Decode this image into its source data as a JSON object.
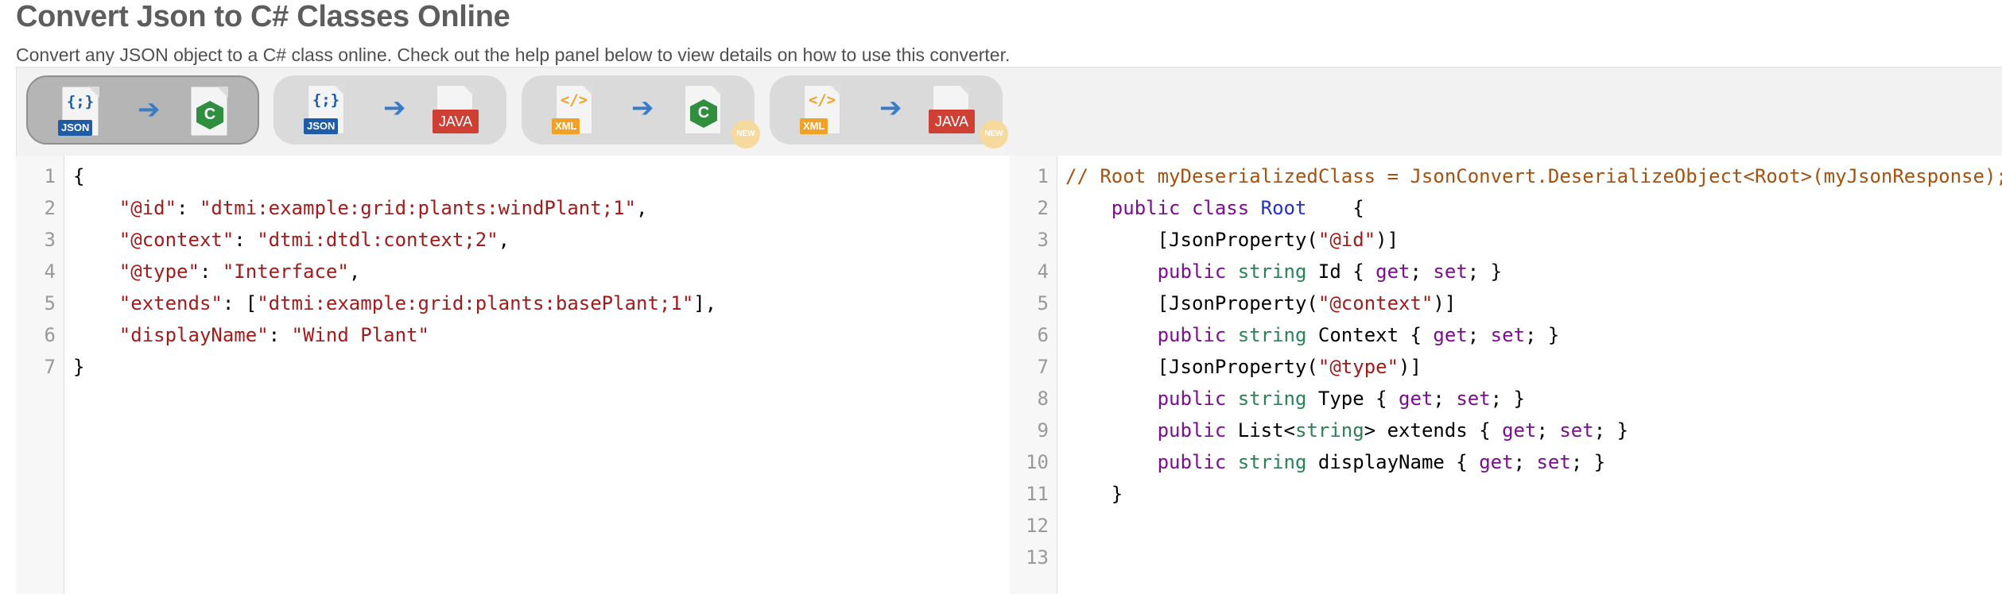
{
  "page": {
    "title": "Convert Json to C# Classes Online",
    "subtitle": "Convert any JSON object to a C# class online. Check out the help panel below to view details on how to use this converter."
  },
  "converters": [
    {
      "from_label": "JSON",
      "from_glyph": "{;}",
      "to_label": "C",
      "active": true,
      "new": false
    },
    {
      "from_label": "JSON",
      "from_glyph": "{;}",
      "to_label": "JAVA",
      "active": false,
      "new": false
    },
    {
      "from_label": "XML",
      "from_glyph": "</>",
      "to_label": "C",
      "active": false,
      "new": true
    },
    {
      "from_label": "XML",
      "from_glyph": "</>",
      "to_label": "JAVA",
      "active": false,
      "new": true
    }
  ],
  "arrow_glyph": "➔",
  "new_badge_text": "NEW",
  "input_editor": {
    "line_numbers": [
      "1",
      "2",
      "3",
      "4",
      "5",
      "6",
      "7"
    ],
    "lines": [
      [
        {
          "cls": "d",
          "text": "{"
        }
      ],
      [
        {
          "cls": "s",
          "text": "    \"@id\""
        },
        {
          "cls": "d",
          "text": ": "
        },
        {
          "cls": "s",
          "text": "\"dtmi:example:grid:plants:windPlant;1\""
        },
        {
          "cls": "d",
          "text": ","
        }
      ],
      [
        {
          "cls": "s",
          "text": "    \"@context\""
        },
        {
          "cls": "d",
          "text": ": "
        },
        {
          "cls": "s",
          "text": "\"dtmi:dtdl:context;2\""
        },
        {
          "cls": "d",
          "text": ","
        }
      ],
      [
        {
          "cls": "s",
          "text": "    \"@type\""
        },
        {
          "cls": "d",
          "text": ": "
        },
        {
          "cls": "s",
          "text": "\"Interface\""
        },
        {
          "cls": "d",
          "text": ","
        }
      ],
      [
        {
          "cls": "s",
          "text": "    \"extends\""
        },
        {
          "cls": "d",
          "text": ": ["
        },
        {
          "cls": "s",
          "text": "\"dtmi:example:grid:plants:basePlant;1\""
        },
        {
          "cls": "d",
          "text": "],"
        }
      ],
      [
        {
          "cls": "s",
          "text": "    \"displayName\""
        },
        {
          "cls": "d",
          "text": ": "
        },
        {
          "cls": "s",
          "text": "\"Wind Plant\""
        }
      ],
      [
        {
          "cls": "d",
          "text": "}"
        }
      ]
    ]
  },
  "output_editor": {
    "line_numbers": [
      "1",
      "2",
      "3",
      "4",
      "5",
      "6",
      "7",
      "8",
      "9",
      "10",
      "11",
      "12",
      "13"
    ],
    "lines": [
      [
        {
          "cls": "c",
          "text": "// Root myDeserializedClass = JsonConvert.DeserializeObject<Root>(myJsonResponse);"
        }
      ],
      [
        {
          "cls": "k",
          "text": "    public class "
        },
        {
          "cls": "p",
          "text": "Root"
        },
        {
          "cls": "d",
          "text": "    {"
        }
      ],
      [
        {
          "cls": "d",
          "text": "        [JsonProperty("
        },
        {
          "cls": "s",
          "text": "\"@id\""
        },
        {
          "cls": "d",
          "text": ")]"
        }
      ],
      [
        {
          "cls": "k",
          "text": "        public "
        },
        {
          "cls": "t",
          "text": "string"
        },
        {
          "cls": "d",
          "text": " Id { "
        },
        {
          "cls": "k",
          "text": "get"
        },
        {
          "cls": "d",
          "text": "; "
        },
        {
          "cls": "k",
          "text": "set"
        },
        {
          "cls": "d",
          "text": "; }"
        }
      ],
      [
        {
          "cls": "d",
          "text": "        [JsonProperty("
        },
        {
          "cls": "s",
          "text": "\"@context\""
        },
        {
          "cls": "d",
          "text": ")]"
        }
      ],
      [
        {
          "cls": "k",
          "text": "        public "
        },
        {
          "cls": "t",
          "text": "string"
        },
        {
          "cls": "d",
          "text": " Context { "
        },
        {
          "cls": "k",
          "text": "get"
        },
        {
          "cls": "d",
          "text": "; "
        },
        {
          "cls": "k",
          "text": "set"
        },
        {
          "cls": "d",
          "text": "; }"
        }
      ],
      [
        {
          "cls": "d",
          "text": "        [JsonProperty("
        },
        {
          "cls": "s",
          "text": "\"@type\""
        },
        {
          "cls": "d",
          "text": ")]"
        }
      ],
      [
        {
          "cls": "k",
          "text": "        public "
        },
        {
          "cls": "t",
          "text": "string"
        },
        {
          "cls": "d",
          "text": " Type { "
        },
        {
          "cls": "k",
          "text": "get"
        },
        {
          "cls": "d",
          "text": "; "
        },
        {
          "cls": "k",
          "text": "set"
        },
        {
          "cls": "d",
          "text": "; }"
        }
      ],
      [
        {
          "cls": "k",
          "text": "        public "
        },
        {
          "cls": "d",
          "text": "List<"
        },
        {
          "cls": "t",
          "text": "string"
        },
        {
          "cls": "d",
          "text": "> extends { "
        },
        {
          "cls": "k",
          "text": "get"
        },
        {
          "cls": "d",
          "text": "; "
        },
        {
          "cls": "k",
          "text": "set"
        },
        {
          "cls": "d",
          "text": "; }"
        }
      ],
      [
        {
          "cls": "k",
          "text": "        public "
        },
        {
          "cls": "t",
          "text": "string"
        },
        {
          "cls": "d",
          "text": " displayName { "
        },
        {
          "cls": "k",
          "text": "get"
        },
        {
          "cls": "d",
          "text": "; "
        },
        {
          "cls": "k",
          "text": "set"
        },
        {
          "cls": "d",
          "text": "; }"
        }
      ],
      [
        {
          "cls": "d",
          "text": "    }"
        }
      ],
      [
        {
          "cls": "d",
          "text": ""
        }
      ],
      [
        {
          "cls": "d",
          "text": ""
        }
      ]
    ]
  }
}
